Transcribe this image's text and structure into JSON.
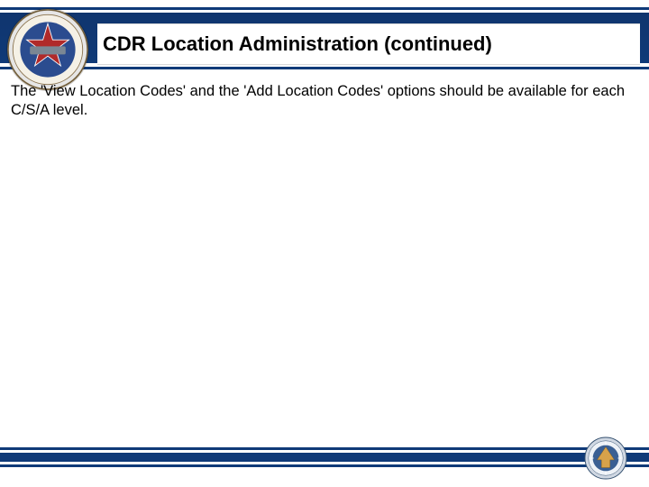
{
  "colors": {
    "navy": "#0f3a78",
    "white": "#ffffff"
  },
  "header": {
    "title": "CDR Location Administration (continued)"
  },
  "body": {
    "paragraph": "The 'View Location Codes' and the 'Add Location Codes' options should be available for each C/S/A level."
  },
  "footer": {
    "slide_number": ""
  },
  "icons": {
    "header_seal": "org-seal-icon",
    "footer_seal": "dod-seal-icon"
  }
}
